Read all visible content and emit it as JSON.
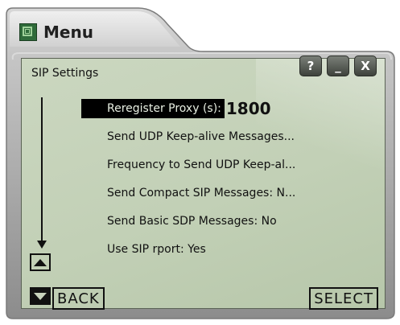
{
  "window": {
    "title": "Menu"
  },
  "screen": {
    "title": "SIP Settings",
    "buttons": {
      "help": "?",
      "minimize": "_",
      "close": "X"
    },
    "items": [
      {
        "label": "Reregister Proxy (s):",
        "value": "1800",
        "selected": true
      },
      {
        "label": "Send UDP Keep-alive Messages..."
      },
      {
        "label": "Frequency to Send UDP Keep-al..."
      },
      {
        "label": "Send Compact SIP Messages: N..."
      },
      {
        "label": "Send Basic SDP Messages: No"
      },
      {
        "label": "Use SIP rport: Yes"
      }
    ],
    "softkeys": {
      "back": "BACK",
      "select": "SELECT"
    }
  },
  "colors": {
    "screen_bg": "#c2d0b6",
    "chrome": "#9a9a9a",
    "selection": "#000000"
  },
  "icons": {
    "app": "menu-app-icon",
    "scroll_up": "triangle-up-icon",
    "scroll_down": "triangle-down-icon"
  }
}
